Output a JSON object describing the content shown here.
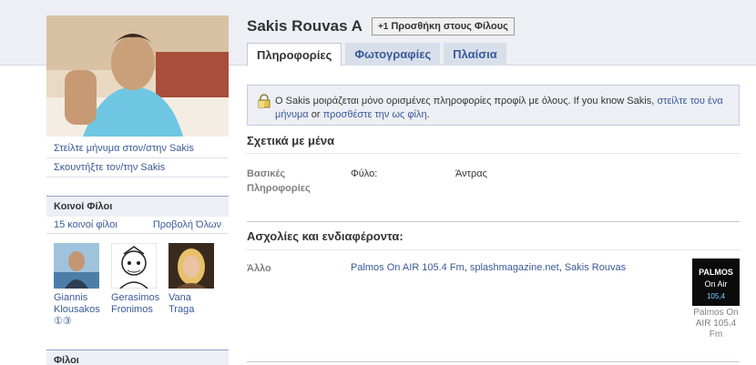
{
  "profile": {
    "name": "Sakis Rouvas A",
    "add_friend": "Προσθήκη στους Φίλους",
    "add_icon_text": "+1"
  },
  "left": {
    "links": [
      "Στείλτε μήνυμα στον/στην Sakis",
      "Σκουντήξτε τον/την Sakis"
    ],
    "mutual_title": "Κοινοί Φίλοι",
    "mutual_count": "15 κοινοί φίλοι",
    "view_all": "Προβολή Όλων",
    "friends": [
      {
        "name": "Giannis Klousakos ①③"
      },
      {
        "name": "Gerasimos Fronimos"
      },
      {
        "name": "Vana Traga"
      }
    ],
    "friends_title": "Φίλοι"
  },
  "tabs": [
    {
      "label": "Πληροφορίες",
      "active": true
    },
    {
      "label": "Φωτογραφίες",
      "active": false
    },
    {
      "label": "Πλαίσια",
      "active": false
    }
  ],
  "notice": {
    "text1": "Ο Sakis μοιράζεται μόνο ορισμένες πληροφορίες προφίλ με όλους. If you know Sakis, ",
    "link1": "στείλτε του ένα μήνυμα",
    "text2": " or ",
    "link2": "προσθέστε την ως φίλη",
    "text3": "."
  },
  "about": {
    "title": "Σχετικά με μένα",
    "basic_label": "Βασικές Πληροφορίες",
    "gender_label": "Φύλο:",
    "gender_value": "Άντρας"
  },
  "interests": {
    "title": "Ασχολίες και ενδιαφέροντα:",
    "other_label": "Άλλο",
    "items": [
      "Palmos On AIR 105.4 Fm",
      "splashmagazine.net",
      "Sakis Rouvas"
    ],
    "sep1": ", ",
    "sep2": ", ",
    "thumb_caption": "Palmos On AIR 105.4 Fm",
    "thumb_text_top": "PALMOS",
    "thumb_text_mid": "On Air",
    "thumb_text_bot": "105,4"
  }
}
